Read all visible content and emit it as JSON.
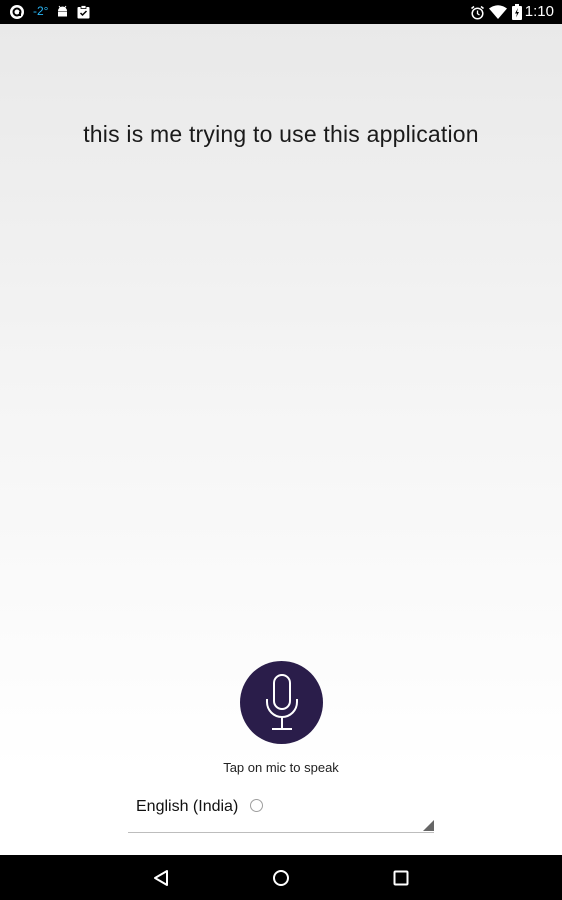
{
  "status_bar": {
    "temperature": "-2°",
    "time": "1:10",
    "icons": [
      "app-notification-icon",
      "android-debug-icon",
      "clipboard-icon",
      "alarm-icon",
      "wifi-icon",
      "battery-icon"
    ]
  },
  "main": {
    "transcript": "this is me trying to use this application",
    "mic_hint": "Tap on mic to speak",
    "language": "English (India)"
  },
  "nav_bar": {
    "icons": [
      "back-icon",
      "home-icon",
      "recents-icon"
    ]
  },
  "colors": {
    "mic_button": "#2a1d4a",
    "temp_text": "#29b6f6"
  }
}
